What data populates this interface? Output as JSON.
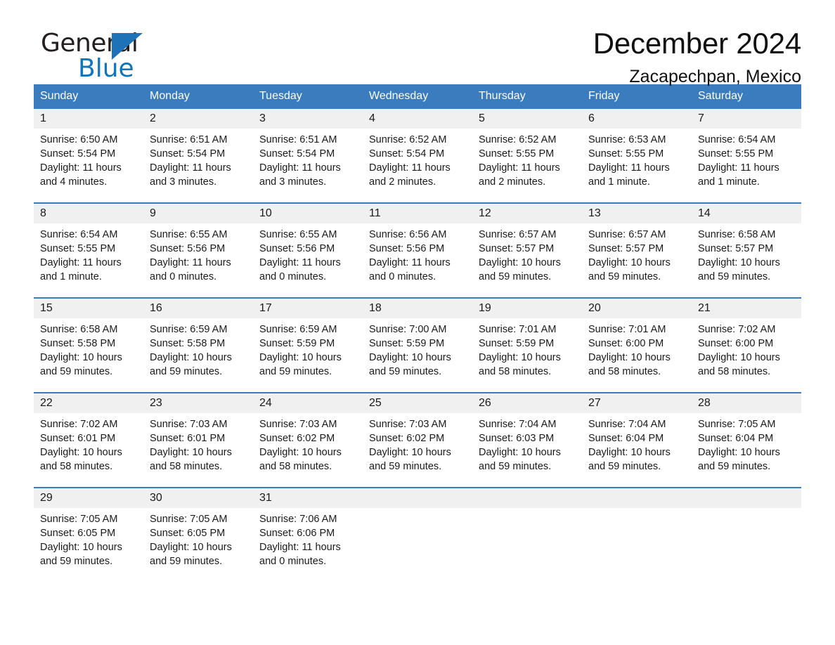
{
  "brand": {
    "line1": "General",
    "line2": "Blue",
    "triangle_color": "#1d72b8",
    "blue_text_color": "#0e76bc"
  },
  "header": {
    "title": "December 2024",
    "location": "Zacapechpan, Mexico"
  },
  "theme": {
    "header_blue": "#3a7cbe",
    "daynum_bg": "#f0f0f0",
    "divider_blue": "#3a7cbe"
  },
  "weekday_headers": [
    "Sunday",
    "Monday",
    "Tuesday",
    "Wednesday",
    "Thursday",
    "Friday",
    "Saturday"
  ],
  "labels": {
    "sunrise": "Sunrise:",
    "sunset": "Sunset:",
    "daylight": "Daylight:"
  },
  "weeks": [
    [
      {
        "day": "1",
        "sunrise": "Sunrise: 6:50 AM",
        "sunset": "Sunset: 5:54 PM",
        "daylight_l1": "Daylight: 11 hours",
        "daylight_l2": "and 4 minutes."
      },
      {
        "day": "2",
        "sunrise": "Sunrise: 6:51 AM",
        "sunset": "Sunset: 5:54 PM",
        "daylight_l1": "Daylight: 11 hours",
        "daylight_l2": "and 3 minutes."
      },
      {
        "day": "3",
        "sunrise": "Sunrise: 6:51 AM",
        "sunset": "Sunset: 5:54 PM",
        "daylight_l1": "Daylight: 11 hours",
        "daylight_l2": "and 3 minutes."
      },
      {
        "day": "4",
        "sunrise": "Sunrise: 6:52 AM",
        "sunset": "Sunset: 5:54 PM",
        "daylight_l1": "Daylight: 11 hours",
        "daylight_l2": "and 2 minutes."
      },
      {
        "day": "5",
        "sunrise": "Sunrise: 6:52 AM",
        "sunset": "Sunset: 5:55 PM",
        "daylight_l1": "Daylight: 11 hours",
        "daylight_l2": "and 2 minutes."
      },
      {
        "day": "6",
        "sunrise": "Sunrise: 6:53 AM",
        "sunset": "Sunset: 5:55 PM",
        "daylight_l1": "Daylight: 11 hours",
        "daylight_l2": "and 1 minute."
      },
      {
        "day": "7",
        "sunrise": "Sunrise: 6:54 AM",
        "sunset": "Sunset: 5:55 PM",
        "daylight_l1": "Daylight: 11 hours",
        "daylight_l2": "and 1 minute."
      }
    ],
    [
      {
        "day": "8",
        "sunrise": "Sunrise: 6:54 AM",
        "sunset": "Sunset: 5:55 PM",
        "daylight_l1": "Daylight: 11 hours",
        "daylight_l2": "and 1 minute."
      },
      {
        "day": "9",
        "sunrise": "Sunrise: 6:55 AM",
        "sunset": "Sunset: 5:56 PM",
        "daylight_l1": "Daylight: 11 hours",
        "daylight_l2": "and 0 minutes."
      },
      {
        "day": "10",
        "sunrise": "Sunrise: 6:55 AM",
        "sunset": "Sunset: 5:56 PM",
        "daylight_l1": "Daylight: 11 hours",
        "daylight_l2": "and 0 minutes."
      },
      {
        "day": "11",
        "sunrise": "Sunrise: 6:56 AM",
        "sunset": "Sunset: 5:56 PM",
        "daylight_l1": "Daylight: 11 hours",
        "daylight_l2": "and 0 minutes."
      },
      {
        "day": "12",
        "sunrise": "Sunrise: 6:57 AM",
        "sunset": "Sunset: 5:57 PM",
        "daylight_l1": "Daylight: 10 hours",
        "daylight_l2": "and 59 minutes."
      },
      {
        "day": "13",
        "sunrise": "Sunrise: 6:57 AM",
        "sunset": "Sunset: 5:57 PM",
        "daylight_l1": "Daylight: 10 hours",
        "daylight_l2": "and 59 minutes."
      },
      {
        "day": "14",
        "sunrise": "Sunrise: 6:58 AM",
        "sunset": "Sunset: 5:57 PM",
        "daylight_l1": "Daylight: 10 hours",
        "daylight_l2": "and 59 minutes."
      }
    ],
    [
      {
        "day": "15",
        "sunrise": "Sunrise: 6:58 AM",
        "sunset": "Sunset: 5:58 PM",
        "daylight_l1": "Daylight: 10 hours",
        "daylight_l2": "and 59 minutes."
      },
      {
        "day": "16",
        "sunrise": "Sunrise: 6:59 AM",
        "sunset": "Sunset: 5:58 PM",
        "daylight_l1": "Daylight: 10 hours",
        "daylight_l2": "and 59 minutes."
      },
      {
        "day": "17",
        "sunrise": "Sunrise: 6:59 AM",
        "sunset": "Sunset: 5:59 PM",
        "daylight_l1": "Daylight: 10 hours",
        "daylight_l2": "and 59 minutes."
      },
      {
        "day": "18",
        "sunrise": "Sunrise: 7:00 AM",
        "sunset": "Sunset: 5:59 PM",
        "daylight_l1": "Daylight: 10 hours",
        "daylight_l2": "and 59 minutes."
      },
      {
        "day": "19",
        "sunrise": "Sunrise: 7:01 AM",
        "sunset": "Sunset: 5:59 PM",
        "daylight_l1": "Daylight: 10 hours",
        "daylight_l2": "and 58 minutes."
      },
      {
        "day": "20",
        "sunrise": "Sunrise: 7:01 AM",
        "sunset": "Sunset: 6:00 PM",
        "daylight_l1": "Daylight: 10 hours",
        "daylight_l2": "and 58 minutes."
      },
      {
        "day": "21",
        "sunrise": "Sunrise: 7:02 AM",
        "sunset": "Sunset: 6:00 PM",
        "daylight_l1": "Daylight: 10 hours",
        "daylight_l2": "and 58 minutes."
      }
    ],
    [
      {
        "day": "22",
        "sunrise": "Sunrise: 7:02 AM",
        "sunset": "Sunset: 6:01 PM",
        "daylight_l1": "Daylight: 10 hours",
        "daylight_l2": "and 58 minutes."
      },
      {
        "day": "23",
        "sunrise": "Sunrise: 7:03 AM",
        "sunset": "Sunset: 6:01 PM",
        "daylight_l1": "Daylight: 10 hours",
        "daylight_l2": "and 58 minutes."
      },
      {
        "day": "24",
        "sunrise": "Sunrise: 7:03 AM",
        "sunset": "Sunset: 6:02 PM",
        "daylight_l1": "Daylight: 10 hours",
        "daylight_l2": "and 58 minutes."
      },
      {
        "day": "25",
        "sunrise": "Sunrise: 7:03 AM",
        "sunset": "Sunset: 6:02 PM",
        "daylight_l1": "Daylight: 10 hours",
        "daylight_l2": "and 59 minutes."
      },
      {
        "day": "26",
        "sunrise": "Sunrise: 7:04 AM",
        "sunset": "Sunset: 6:03 PM",
        "daylight_l1": "Daylight: 10 hours",
        "daylight_l2": "and 59 minutes."
      },
      {
        "day": "27",
        "sunrise": "Sunrise: 7:04 AM",
        "sunset": "Sunset: 6:04 PM",
        "daylight_l1": "Daylight: 10 hours",
        "daylight_l2": "and 59 minutes."
      },
      {
        "day": "28",
        "sunrise": "Sunrise: 7:05 AM",
        "sunset": "Sunset: 6:04 PM",
        "daylight_l1": "Daylight: 10 hours",
        "daylight_l2": "and 59 minutes."
      }
    ],
    [
      {
        "day": "29",
        "sunrise": "Sunrise: 7:05 AM",
        "sunset": "Sunset: 6:05 PM",
        "daylight_l1": "Daylight: 10 hours",
        "daylight_l2": "and 59 minutes."
      },
      {
        "day": "30",
        "sunrise": "Sunrise: 7:05 AM",
        "sunset": "Sunset: 6:05 PM",
        "daylight_l1": "Daylight: 10 hours",
        "daylight_l2": "and 59 minutes."
      },
      {
        "day": "31",
        "sunrise": "Sunrise: 7:06 AM",
        "sunset": "Sunset: 6:06 PM",
        "daylight_l1": "Daylight: 11 hours",
        "daylight_l2": "and 0 minutes."
      },
      {
        "day": "",
        "sunrise": "",
        "sunset": "",
        "daylight_l1": "",
        "daylight_l2": ""
      },
      {
        "day": "",
        "sunrise": "",
        "sunset": "",
        "daylight_l1": "",
        "daylight_l2": ""
      },
      {
        "day": "",
        "sunrise": "",
        "sunset": "",
        "daylight_l1": "",
        "daylight_l2": ""
      },
      {
        "day": "",
        "sunrise": "",
        "sunset": "",
        "daylight_l1": "",
        "daylight_l2": ""
      }
    ]
  ]
}
